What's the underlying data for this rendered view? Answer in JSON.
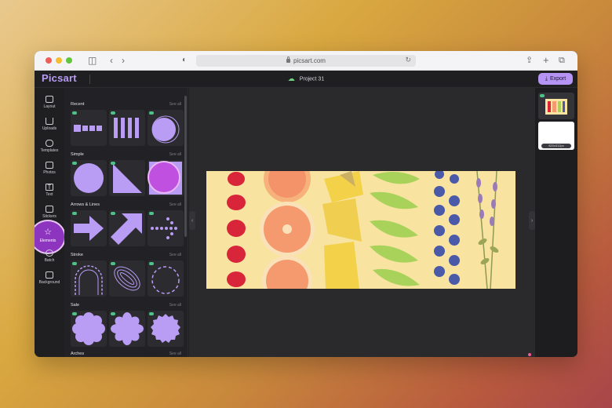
{
  "browser": {
    "url": "picsart.com"
  },
  "app": {
    "logo": "Picsart",
    "project_title": "Project 31",
    "export_label": "Export"
  },
  "rail": {
    "items": [
      {
        "label": "Layout"
      },
      {
        "label": "Uploads"
      },
      {
        "label": "Templates"
      },
      {
        "label": "Photos"
      },
      {
        "label": "Text"
      },
      {
        "label": "Stickers"
      },
      {
        "label": "Elements"
      },
      {
        "label": "Batch"
      },
      {
        "label": "Background"
      }
    ]
  },
  "panel": {
    "see_all": "See all",
    "sections": [
      {
        "title": "Recent"
      },
      {
        "title": "Simple"
      },
      {
        "title": "Arrows & Lines"
      },
      {
        "title": "Stroke"
      },
      {
        "title": "Sale"
      },
      {
        "title": "Arches"
      }
    ]
  },
  "right_panel": {
    "size_label": "820x312px"
  },
  "colors": {
    "accent": "#b594f5",
    "shape": "#b99cf4",
    "selected_shape": "#c051e0",
    "artboard_bg": "#f8e3a1"
  }
}
